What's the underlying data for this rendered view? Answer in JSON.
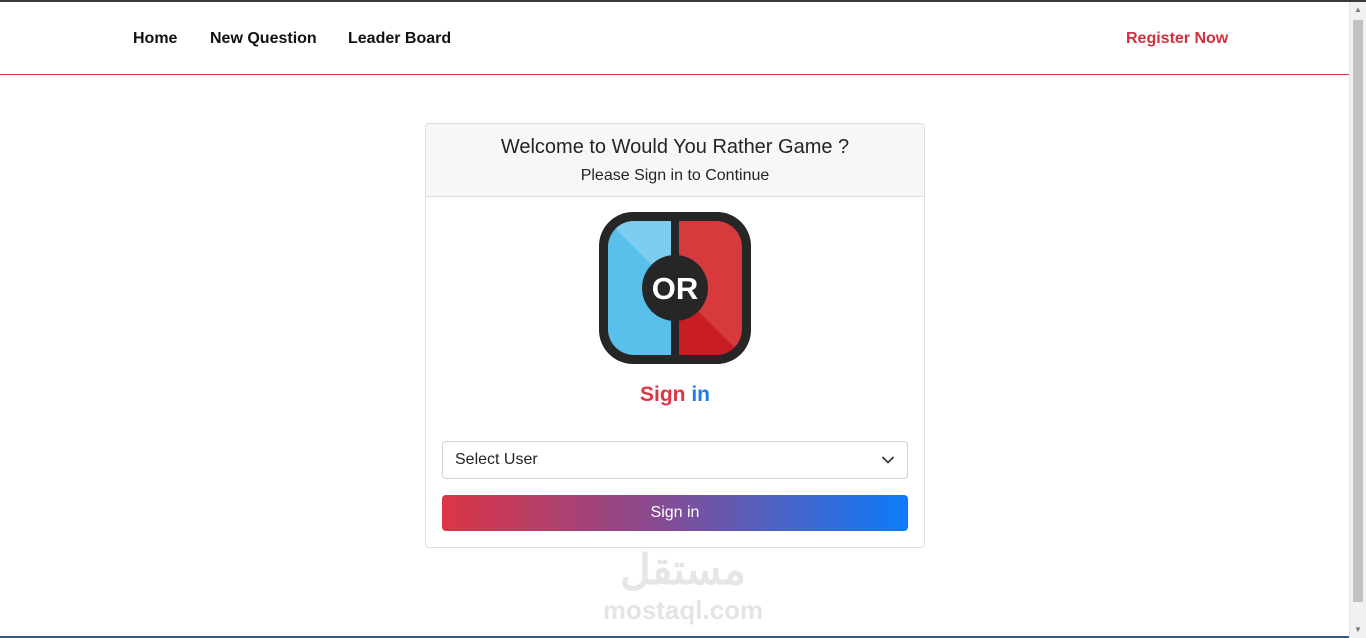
{
  "nav": {
    "items": [
      {
        "label": "Home"
      },
      {
        "label": "New Question"
      },
      {
        "label": "Leader Board"
      }
    ],
    "register_label": "Register Now"
  },
  "card": {
    "title": "Welcome to Would You Rather Game ?",
    "subtitle": "Please Sign in to Continue",
    "logo_text": "OR",
    "heading_sign": "Sign",
    "heading_in": "in",
    "select": {
      "value": "Select User"
    },
    "submit_label": "Sign in"
  },
  "watermark": {
    "arabic": "مستقل",
    "latin": "mostaql.com"
  },
  "colors": {
    "accent_red": "#dc3545",
    "accent_blue": "#1e7be6",
    "logo_blue": "#58c0ea",
    "logo_red": "#d63a3d"
  },
  "icons": {
    "select_arrow": "chevron-down-icon",
    "logo": "or-logo-icon"
  }
}
